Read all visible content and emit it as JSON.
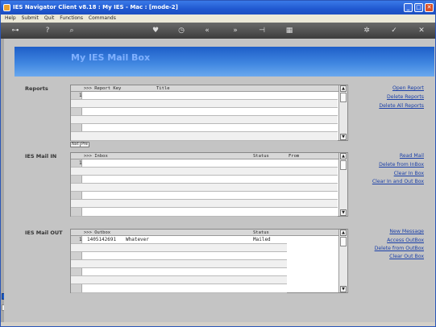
{
  "window": {
    "title": "IES Navigator Client v8.18 : My IES - Mac :      [mode-2]",
    "min": "_",
    "max": "□",
    "close": "✕"
  },
  "menu": [
    "Help",
    "Submit",
    "Quit",
    "Functions",
    "Commands"
  ],
  "toolbar": {
    "icons": [
      "key-icon",
      "help-icon",
      "search-icon",
      "heart-icon",
      "clock-icon",
      "rewind-icon",
      "fast-forward-icon",
      "step-icon",
      "list-icon",
      "settings-icon",
      "check-icon",
      "close-icon"
    ],
    "glyphs": [
      "⊶",
      "?",
      "⌕",
      "♥",
      "◷",
      "«",
      "»",
      "⊣",
      "▦",
      "✲",
      "✓",
      "✕"
    ]
  },
  "banner": {
    "title": "My IES Mail Box"
  },
  "reports": {
    "section_label": "Reports",
    "columns": [
      ">>> Report Key",
      "Title"
    ],
    "rows": [
      {
        "num": "1",
        "key": "",
        "title": ""
      }
    ],
    "pager": [
      "Nxt",
      "Pre"
    ],
    "actions": [
      "Open Report",
      "Delete Reports",
      "Delete All Reports"
    ]
  },
  "inbox": {
    "section_label": "IES Mail IN",
    "columns": [
      ">>> Inbox",
      "Status",
      "From"
    ],
    "rows": [
      {
        "num": "1",
        "subject": "",
        "status": "",
        "from": ""
      }
    ],
    "actions": [
      "Read Mail",
      "Delete from InBox",
      "Clear In Box",
      "Clear In and Out Box"
    ]
  },
  "outbox": {
    "section_label": "IES Mail OUT",
    "columns": [
      ">>> Outbox",
      "Status"
    ],
    "rows": [
      {
        "num": "1",
        "id": "1405142691",
        "subject": "Whatever",
        "status": "Mailed"
      }
    ],
    "actions": [
      "New Message",
      "Access OutBox",
      "Delete from OutBox",
      "Clear Out Box"
    ]
  }
}
